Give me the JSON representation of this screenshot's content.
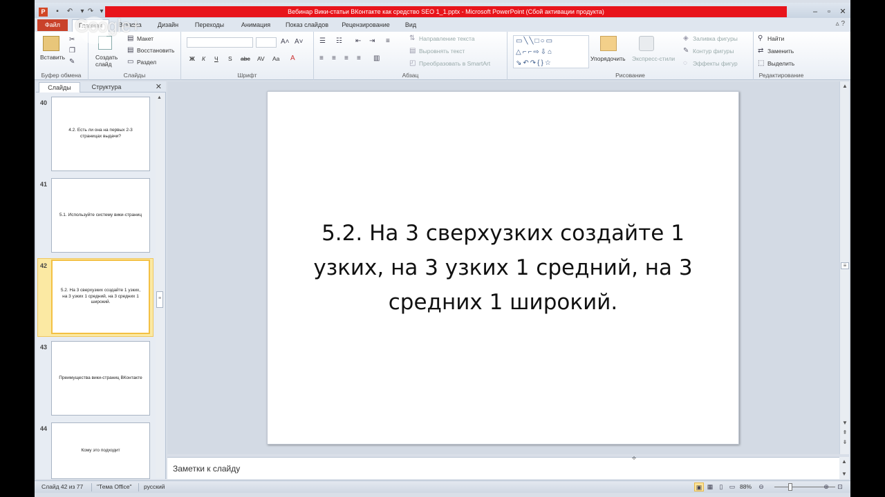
{
  "window": {
    "title": "Вебинар Вики-статьи ВКонтакте как средство SEO 1_1.pptx  -  Microsoft PowerPoint (Сбой активации продукта)",
    "app_icon": "P"
  },
  "tabs": {
    "file": "Файл",
    "items": [
      "Главная",
      "Вставка",
      "Дизайн",
      "Переходы",
      "Анимация",
      "Показ слайдов",
      "Рецензирование",
      "Вид"
    ]
  },
  "ribbon": {
    "clipboard": {
      "paste": "Вставить",
      "label": "Буфер обмена"
    },
    "slides": {
      "new_slide": "Создать слайд",
      "layout": "Макет",
      "reset": "Восстановить",
      "section": "Раздел",
      "label": "Слайды"
    },
    "font": {
      "label": "Шрифт",
      "bold": "Ж",
      "italic": "К",
      "underline": "Ч",
      "shadow": "S",
      "strike": "abc",
      "spacing": "AV",
      "case": "Aa"
    },
    "paragraph": {
      "label": "Абзац",
      "text_direction": "Направление текста",
      "align_text": "Выровнять текст",
      "smartart": "Преобразовать в SmartArt"
    },
    "drawing": {
      "label": "Рисование",
      "arrange": "Упорядочить",
      "quick_styles": "Экспресс-стили",
      "shape_fill": "Заливка фигуры",
      "shape_outline": "Контур фигуры",
      "shape_effects": "Эффекты фигур"
    },
    "editing": {
      "label": "Редактирование",
      "find": "Найти",
      "replace": "Заменить",
      "select": "Выделить"
    }
  },
  "left_pane": {
    "tab_slides": "Слайды",
    "tab_outline": "Структура",
    "thumbnails": [
      {
        "num": "40",
        "text": "4.2. Есть ли она на первых 2-3 страницах выдачи?"
      },
      {
        "num": "41",
        "text": "5.1. Используйте систему вики-страниц"
      },
      {
        "num": "42",
        "text": "5.2. На 3 сверхузких создайте 1 узких, на 3 узких 1 средний, на 3 средних 1 широкий."
      },
      {
        "num": "43",
        "text": "Преимущества вики-страниц ВКонтакте"
      },
      {
        "num": "44",
        "text": "Кому это подходит"
      }
    ]
  },
  "slide": {
    "text": "5.2. На 3 сверхузких создайте 1 узких, на 3 узких 1 средний, на 3 средних 1 широкий."
  },
  "notes": {
    "placeholder": "Заметки к слайду"
  },
  "statusbar": {
    "slide_info": "Слайд 42 из 77",
    "theme": "\"Тема Office\"",
    "language": "русский",
    "zoom": "88%"
  },
  "watermark": {
    "text": "Google+"
  }
}
